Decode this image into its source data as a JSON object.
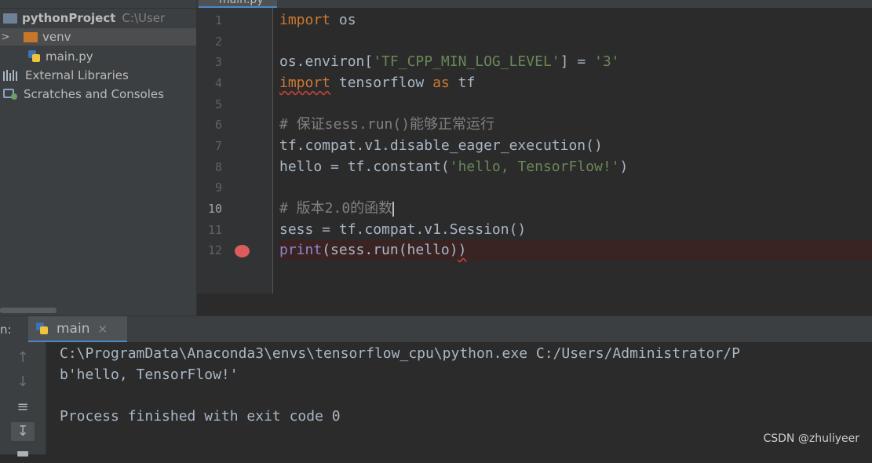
{
  "project": {
    "root_name": "pythonProject",
    "root_path": "C:\\User",
    "items": [
      {
        "label": "venv"
      },
      {
        "label": "main.py"
      },
      {
        "label": "External Libraries"
      },
      {
        "label": "Scratches and Consoles"
      }
    ]
  },
  "editor": {
    "tab_label": "main.py",
    "current_line": 10,
    "breakpoint_line": 12,
    "lines": [
      {
        "n": "1"
      },
      {
        "n": "2"
      },
      {
        "n": "3"
      },
      {
        "n": "4"
      },
      {
        "n": "5"
      },
      {
        "n": "6"
      },
      {
        "n": "7"
      },
      {
        "n": "8"
      },
      {
        "n": "9"
      },
      {
        "n": "10"
      },
      {
        "n": "11"
      },
      {
        "n": "12"
      }
    ],
    "code": {
      "l1_kw": "import",
      "l1_rest": " os",
      "l3_a": "os.environ[",
      "l3_str1": "'TF_CPP_MIN_LOG_LEVEL'",
      "l3_b": "] = ",
      "l3_str2": "'3'",
      "l4_kw1": "import",
      "l4_mid": " tensorflow ",
      "l4_kw2": "as",
      "l4_rest": " tf",
      "l6": "# 保证sess.run()能够正常运行",
      "l7": "tf.compat.v1.disable_eager_execution()",
      "l8_a": "hello = tf.constant(",
      "l8_str": "'hello, TensorFlow!'",
      "l8_b": ")",
      "l10": "# 版本2.0的函数",
      "l11": "sess = tf.compat.v1.Session()",
      "l12_fn": "print",
      "l12_a": "(sess.run(hello)",
      "l12_b": ")"
    }
  },
  "run": {
    "label": "n:",
    "tab_name": "main",
    "tab_close": "×",
    "tools": [
      "arrow-up",
      "arrow-down",
      "soft-wrap",
      "scroll-to-end",
      "clear"
    ],
    "output": [
      "C:\\ProgramData\\Anaconda3\\envs\\tensorflow_cpu\\python.exe C:/Users/Administrator/P",
      "b'hello, TensorFlow!'",
      "",
      "Process finished with exit code 0"
    ]
  },
  "watermark": "CSDN @zhuliyeer",
  "colors": {
    "background": "#2b2b2b",
    "keyword": "#cc7832",
    "string": "#6a8759",
    "comment": "#808080",
    "builtin": "#8888c6",
    "breakpoint": "#db5c5c"
  }
}
